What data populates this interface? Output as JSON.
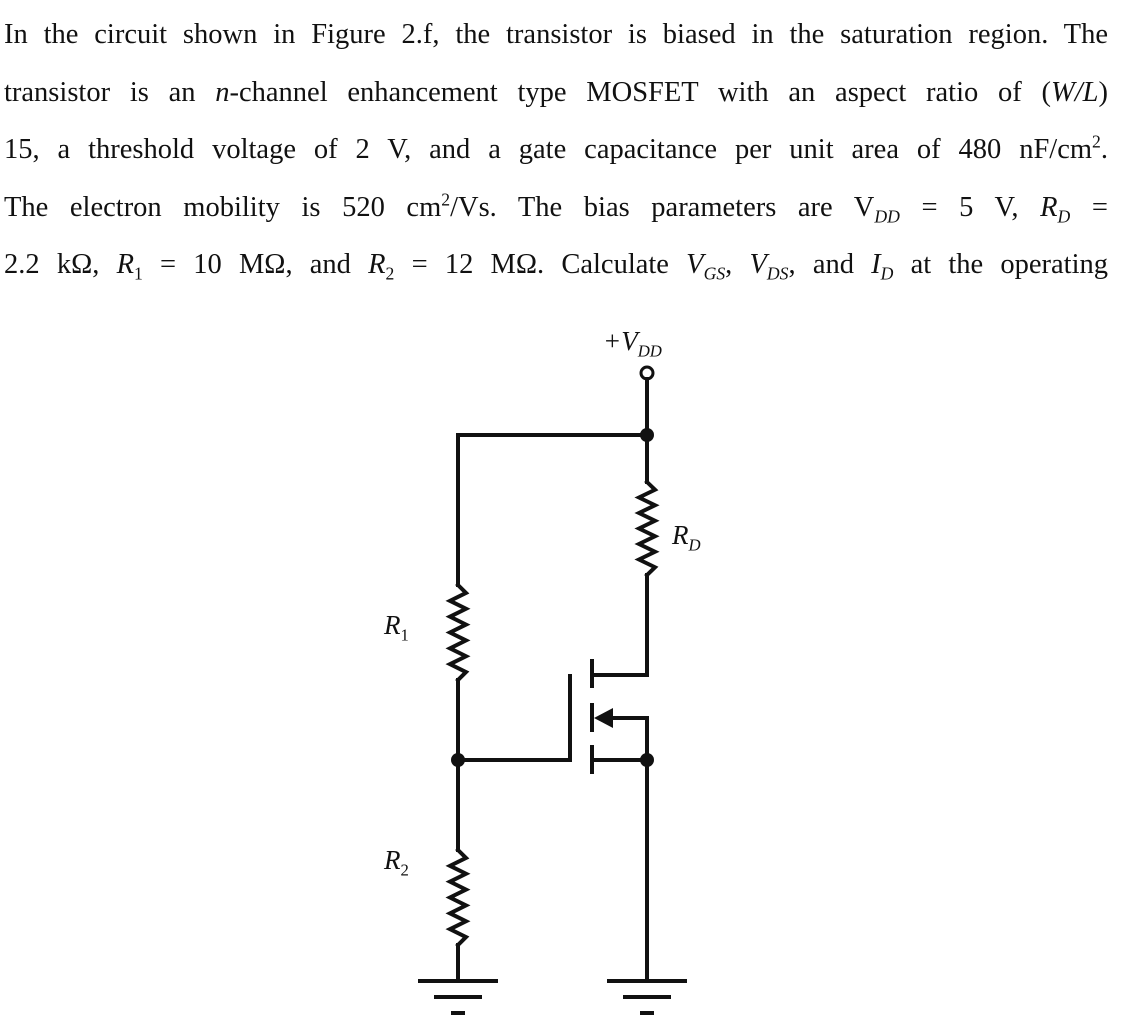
{
  "problem_text": {
    "lines": [
      [
        {
          "t": "In the circuit shown in Figure 2.f, the transistor is biased in the saturation region. The"
        }
      ],
      [
        {
          "t": "transistor is an "
        },
        {
          "t": "n",
          "i": true
        },
        {
          "t": "-channel enhancement type MOSFET with an aspect ratio of ("
        },
        {
          "t": "W/L",
          "i": true
        },
        {
          "t": ")"
        }
      ],
      [
        {
          "t": "15, a threshold voltage of 2 V, and a gate capacitance per unit area of 480 nF/cm"
        },
        {
          "t": "2",
          "sup": true
        },
        {
          "t": "."
        }
      ],
      [
        {
          "t": "The electron mobility is 520 cm"
        },
        {
          "t": "2",
          "sup": true
        },
        {
          "t": "/Vs. The bias parameters are V"
        },
        {
          "t": "DD",
          "sub": true,
          "i": true
        },
        {
          "t": " = 5 V, "
        },
        {
          "t": "R",
          "i": true
        },
        {
          "t": "D",
          "sub": true,
          "i": true
        },
        {
          "t": " ="
        }
      ],
      [
        {
          "t": "2.2 kΩ, "
        },
        {
          "t": "R",
          "i": true
        },
        {
          "t": "1",
          "sub": true
        },
        {
          "t": " = 10 MΩ, and "
        },
        {
          "t": "R",
          "i": true
        },
        {
          "t": "2",
          "sub": true
        },
        {
          "t": " = 12 MΩ. Calculate "
        },
        {
          "t": "V",
          "i": true
        },
        {
          "t": "GS",
          "sub": true,
          "i": true
        },
        {
          "t": ", "
        },
        {
          "t": "V",
          "i": true
        },
        {
          "t": "DS",
          "sub": true,
          "i": true
        },
        {
          "t": ", and "
        },
        {
          "t": "I",
          "i": true
        },
        {
          "t": "D",
          "sub": true,
          "i": true
        },
        {
          "t": " at the operating"
        }
      ]
    ]
  },
  "circuit": {
    "labels": {
      "vdd": {
        "main": "+V",
        "sub": "DD"
      },
      "rd": {
        "main": "R",
        "sub": "D"
      },
      "r1": {
        "main": "R",
        "sub": "1"
      },
      "r2": {
        "main": "R",
        "sub": "2"
      }
    },
    "components": [
      "VDD terminal",
      "RD resistor",
      "R1 resistor",
      "R2 resistor",
      "n-channel enhancement MOSFET",
      "ground",
      "ground"
    ]
  }
}
